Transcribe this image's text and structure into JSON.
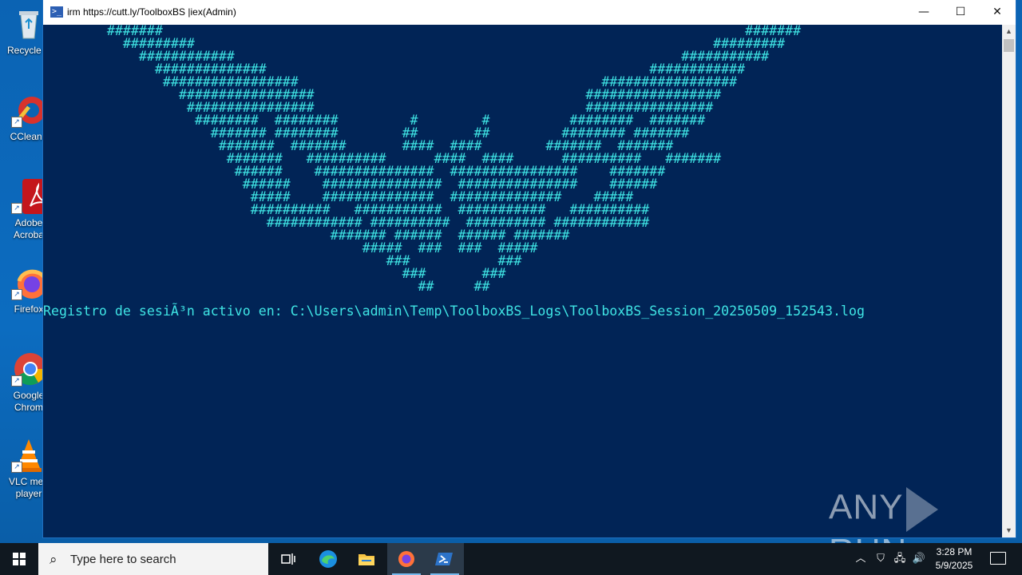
{
  "desktop": {
    "icons": [
      {
        "label": "Recycle Bin",
        "visible_label": "Recycle E"
      },
      {
        "label": "CCleaner",
        "visible_label": "CCleane"
      },
      {
        "label": "Adobe Acrobat",
        "visible_label": "Adobe\nAcroba"
      },
      {
        "label": "Firefox",
        "visible_label": "Firefox"
      },
      {
        "label": "Google Chrome",
        "visible_label": "Google\nChrom"
      },
      {
        "label": "VLC media player",
        "visible_label": "VLC med\nplayer"
      }
    ]
  },
  "window": {
    "title": "irm https://cutt.ly/ToolboxBS |iex(Admin)",
    "controls": {
      "minimize": "—",
      "maximize": "☐",
      "close": "✕"
    },
    "console": {
      "ascii_art": "        #######                                                                         #######\n          #########                                                                 #########\n            ############                                                        ###########\n              ##############                                                ############\n               #################                                      #################\n                 #################                                  #################\n                  ################                                  ################\n                   ########  ########         #        #          ########  #######\n                     ####### ########        ##       ##         ######## #######\n                      #######  #######       ####  ####        #######  #######\n                       #######   ##########      ####  ####      ##########   #######\n                        ######    ###############  ################    #######\n                         ######    ###############  ###############    ######\n                          #####    ##############  ##############    #####\n                          ##########   ###########  ###########   ##########\n                            ############ ##########  ########## ############\n                                    ####### ######  ###### #######\n                                        #####  ###  ###  #####\n                                           ###           ###\n                                             ###       ###\n                                               ##     ##",
      "log_line": "Registro de sesiÃ³n activo en: C:\\Users\\admin\\Temp\\ToolboxBS_Logs\\ToolboxBS_Session_20250509_152543.log"
    },
    "colors": {
      "background": "#012456",
      "text": "#3fe4e4"
    }
  },
  "watermark": {
    "left": "ANY",
    "right": "RUN"
  },
  "taskbar": {
    "search_placeholder": "Type here to search",
    "apps": [
      "task-view",
      "edge",
      "file-explorer",
      "firefox",
      "powershell"
    ],
    "clock": {
      "time": "3:28 PM",
      "date": "5/9/2025"
    }
  }
}
